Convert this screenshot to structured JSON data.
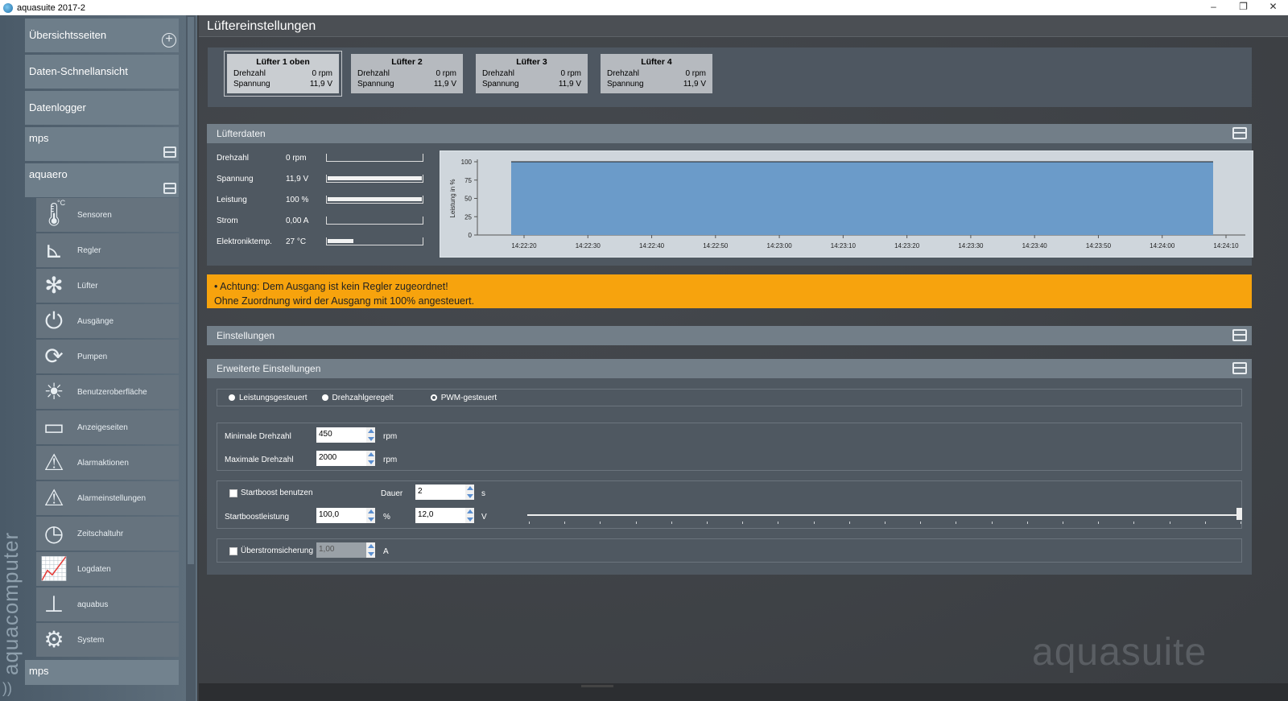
{
  "window": {
    "title": "aquasuite 2017-2",
    "minimize": "–",
    "maximize": "❐",
    "close": "✕"
  },
  "sidebar": {
    "brand": "aquacomputer",
    "sections": [
      {
        "label": "Übersichtsseiten",
        "icon": "plus-circle-icon"
      },
      {
        "label": "Daten-Schnellansicht"
      },
      {
        "label": "Datenlogger"
      },
      {
        "label": "mps",
        "icon": "panel-icon"
      },
      {
        "label": "aquaero",
        "icon": "panel-icon"
      }
    ],
    "items": [
      {
        "label": "Sensoren",
        "icon": "thermometer-icon",
        "glyph": "🌡"
      },
      {
        "label": "Regler",
        "icon": "controller-icon",
        "glyph": "⊾"
      },
      {
        "label": "Lüfter",
        "icon": "fan-icon",
        "glyph": "✻"
      },
      {
        "label": "Ausgänge",
        "icon": "plug-icon",
        "glyph": "⏻"
      },
      {
        "label": "Pumpen",
        "icon": "pump-icon",
        "glyph": "⟳"
      },
      {
        "label": "Benutzeroberfläche",
        "icon": "brightness-icon",
        "glyph": "☀"
      },
      {
        "label": "Anzeigeseiten",
        "icon": "display-pages-icon",
        "glyph": "▭"
      },
      {
        "label": "Alarmaktionen",
        "icon": "alarm-action-icon",
        "glyph": "⚠"
      },
      {
        "label": "Alarmeinstellungen",
        "icon": "alarm-settings-icon",
        "glyph": "⚠"
      },
      {
        "label": "Zeitschaltuhr",
        "icon": "timer-icon",
        "glyph": "◷"
      },
      {
        "label": "Logdaten",
        "icon": "log-chart-icon",
        "glyph": "📈"
      },
      {
        "label": "aquabus",
        "icon": "bus-icon",
        "glyph": "⊥"
      },
      {
        "label": "System",
        "icon": "gear-icon",
        "glyph": "⚙"
      }
    ],
    "bottom": "mps",
    "sensor_icon_unit": "°C"
  },
  "main": {
    "title": "Lüftereinstellungen",
    "fans": [
      {
        "name": "Lüfter 1 oben",
        "speed_label": "Drehzahl",
        "speed": "0 rpm",
        "voltage_label": "Spannung",
        "voltage": "11,9 V"
      },
      {
        "name": "Lüfter 2",
        "speed_label": "Drehzahl",
        "speed": "0 rpm",
        "voltage_label": "Spannung",
        "voltage": "11,9 V"
      },
      {
        "name": "Lüfter 3",
        "speed_label": "Drehzahl",
        "speed": "0 rpm",
        "voltage_label": "Spannung",
        "voltage": "11,9 V"
      },
      {
        "name": "Lüfter 4",
        "speed_label": "Drehzahl",
        "speed": "0 rpm",
        "voltage_label": "Spannung",
        "voltage": "11,9 V"
      }
    ],
    "fandata": {
      "header": "Lüfterdaten",
      "rows": [
        {
          "name": "Drehzahl",
          "value": "0 rpm",
          "level": 0
        },
        {
          "name": "Spannung",
          "value": "11,9 V",
          "level": 1
        },
        {
          "name": "Leistung",
          "value": "100 %",
          "level": 1
        },
        {
          "name": "Strom",
          "value": "0,00 A",
          "level": 0
        },
        {
          "name": "Elektroniktemp.",
          "value": "27 °C",
          "level": 0.27
        }
      ]
    },
    "warning": {
      "line1": "• Achtung: Dem Ausgang ist kein Regler zugeordnet!",
      "line2": "Ohne Zuordnung wird der Ausgang mit 100% angesteuert."
    },
    "settings_header": "Einstellungen",
    "advanced": {
      "header": "Erweiterte Einstellungen",
      "modes": [
        "Leistungsgesteuert",
        "Drehzahlgeregelt",
        "PWM-gesteuert"
      ],
      "selected_mode": "PWM-gesteuert",
      "min_speed_label": "Minimale Drehzahl",
      "min_speed": "450",
      "max_speed_label": "Maximale Drehzahl",
      "max_speed": "2000",
      "rpm_unit": "rpm",
      "startboost_label": "Startboost benutzen",
      "duration_label": "Dauer",
      "duration": "2",
      "duration_unit": "s",
      "startboost_power_label": "Startboostleistung",
      "startboost_power": "100,0",
      "percent_unit": "%",
      "startboost_voltage": "12,0",
      "voltage_unit": "V",
      "startboost_level": 1,
      "overcurrent_label": "Überstromsicherung",
      "overcurrent": "1,00",
      "ampere_unit": "A"
    },
    "watermark": "aquasuite"
  },
  "chart_data": {
    "type": "area",
    "ylabel": "Leistung in %",
    "ylim": [
      0,
      100
    ],
    "yticks": [
      0,
      25,
      50,
      75,
      100
    ],
    "x": [
      "14:22:20",
      "14:22:30",
      "14:22:40",
      "14:22:50",
      "14:23:00",
      "14:23:10",
      "14:23:20",
      "14:23:30",
      "14:23:40",
      "14:23:50",
      "14:24:00",
      "14:24:10"
    ],
    "series": [
      {
        "values": [
          100,
          100,
          100,
          100,
          100,
          100,
          100,
          100,
          100,
          100,
          100,
          100
        ]
      }
    ],
    "fill_color": "#6b9bc9",
    "grid": false
  }
}
